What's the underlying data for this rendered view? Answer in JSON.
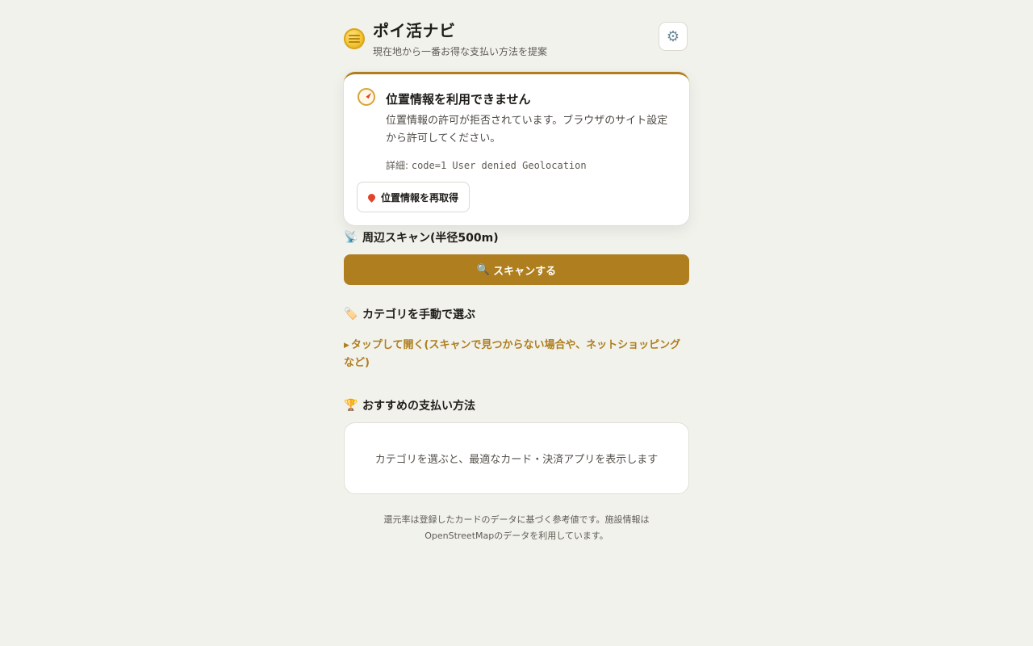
{
  "header": {
    "title": "ポイ活ナビ",
    "subtitle": "現在地から一番お得な支払い方法を提案",
    "logo_icon": "coin-icon",
    "settings_icon": "gear-icon",
    "settings_glyph": "⚙"
  },
  "location_alert": {
    "icon": "compass-icon",
    "title": "位置情報を利用できません",
    "message": "位置情報の許可が拒否されています。ブラウザのサイト設定から許可してください。",
    "detail_label": "詳細: ",
    "detail_code": "code=1 User denied Geolocation",
    "retry_label": "位置情報を再取得",
    "accent_color": "#b07e1f"
  },
  "scan": {
    "heading_icon": "📡",
    "heading": "周辺スキャン(半径500m)",
    "button_icon": "🔍",
    "button_label": "スキャンする",
    "button_color": "#af7f1f"
  },
  "category": {
    "heading_icon": "🏷️",
    "heading": "カテゴリを手動で選ぶ",
    "toggle_marker": "▶",
    "toggle_label": "タップして開く(スキャンで見つからない場合や、ネットショッピングなど)"
  },
  "recommend": {
    "heading_icon": "🏆",
    "heading": "おすすめの支払い方法",
    "empty_message": "カテゴリを選ぶと、最適なカード・決済アプリを表示します"
  },
  "footer": {
    "note": "還元率は登録したカードのデータに基づく参考値です。施設情報はOpenStreetMapのデータを利用しています。"
  }
}
